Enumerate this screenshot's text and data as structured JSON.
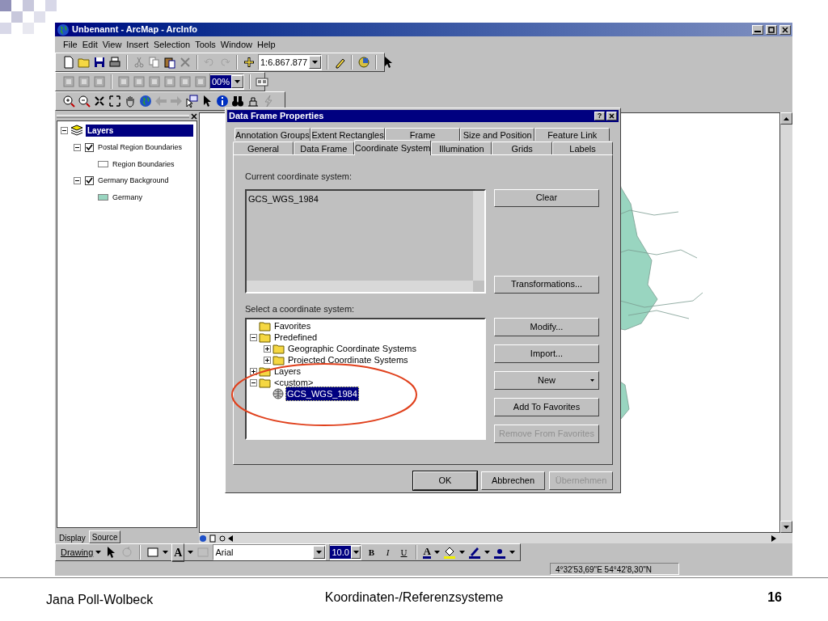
{
  "app": {
    "title": "Unbenannt - ArcMap - ArcInfo",
    "menu": [
      {
        "label": "File"
      },
      {
        "label": "Edit"
      },
      {
        "label": "View"
      },
      {
        "label": "Insert"
      },
      {
        "label": "Selection"
      },
      {
        "label": "Tools"
      },
      {
        "label": "Window"
      },
      {
        "label": "Help"
      }
    ],
    "scale": "1:6.867.877",
    "zoom_percent": "00%",
    "toc": {
      "label": "Layers",
      "selected": true,
      "expanded": true,
      "children": [
        {
          "label": "Postal Region Boundaries",
          "checked": true,
          "expanded": true,
          "children": [
            {
              "label": "Region Boundaries",
              "color": "#ffffff"
            }
          ]
        },
        {
          "label": "Germany Background",
          "checked": true,
          "expanded": true,
          "children": [
            {
              "label": "Germany",
              "color": "#99d5c0"
            }
          ]
        }
      ]
    },
    "toc_tabs": [
      {
        "label": "Display",
        "selected": false
      },
      {
        "label": "Source",
        "selected": true
      }
    ],
    "drawing_toolbar": {
      "menu": "Drawing",
      "text_tool": "A",
      "font": "Arial",
      "font_size": "10.0",
      "format": [
        "B",
        "I",
        "U"
      ],
      "font_color": "A"
    },
    "status_coordinates": "4°32'53,69\"E  54°42'8,30\"N"
  },
  "dialog": {
    "title": "Data Frame Properties",
    "help": "?",
    "tab_rows": [
      [
        {
          "label": "Annotation Groups",
          "selected": false
        },
        {
          "label": "Extent Rectangles",
          "selected": false
        },
        {
          "label": "Frame",
          "selected": false
        },
        {
          "label": "Size and Position",
          "selected": false
        },
        {
          "label": "Feature Link",
          "selected": false
        }
      ],
      [
        {
          "label": "General",
          "selected": false
        },
        {
          "label": "Data Frame",
          "selected": false
        },
        {
          "label": "Coordinate System",
          "selected": true
        },
        {
          "label": "Illumination",
          "selected": false
        },
        {
          "label": "Grids",
          "selected": false
        },
        {
          "label": "Labels",
          "selected": false
        }
      ]
    ],
    "current_label": "Current coordinate system:",
    "current_value": "GCS_WGS_1984",
    "select_label": "Select a coordinate system:",
    "tree": [
      {
        "label": "Favorites",
        "kind": "folder",
        "selected": false
      },
      {
        "label": "Predefined",
        "kind": "folder",
        "expanded": true,
        "selected": false,
        "children": [
          {
            "label": "Geographic Coordinate Systems",
            "kind": "folder",
            "expanded": false,
            "selected": false
          },
          {
            "label": "Projected Coordinate Systems",
            "kind": "folder",
            "expanded": false,
            "selected": false
          }
        ]
      },
      {
        "label": "Layers",
        "kind": "folder",
        "expanded": false,
        "selected": false
      },
      {
        "label": "<custom>",
        "kind": "folder",
        "expanded": true,
        "selected": false,
        "children": [
          {
            "label": "GCS_WGS_1984",
            "kind": "globe",
            "selected": true
          }
        ]
      }
    ],
    "upper_buttons": [
      {
        "label": "Clear",
        "disabled": false
      },
      {
        "label": "Transformations...",
        "disabled": false
      }
    ],
    "side_buttons": [
      {
        "label": "Modify...",
        "disabled": false,
        "dropdown": false
      },
      {
        "label": "Import...",
        "disabled": false,
        "dropdown": false
      },
      {
        "label": "New",
        "disabled": false,
        "dropdown": true
      },
      {
        "label": "Add To Favorites",
        "disabled": false,
        "dropdown": false
      },
      {
        "label": "Remove From Favorites",
        "disabled": true,
        "dropdown": false
      }
    ],
    "bottom_buttons": [
      {
        "label": "OK",
        "disabled": false
      },
      {
        "label": "Abbrechen",
        "disabled": false
      },
      {
        "label": "Übernehmen",
        "disabled": true
      }
    ]
  },
  "footer": {
    "author": "Jana Poll-Wolbeck",
    "title": "Koordinaten-/Referenzsysteme",
    "page": "16"
  }
}
